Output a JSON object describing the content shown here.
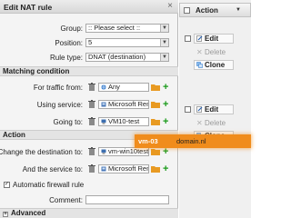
{
  "dialog": {
    "title": "Edit NAT rule",
    "close_glyph": "×",
    "group": {
      "label": "Group:",
      "value": ":: Please select ::"
    },
    "position": {
      "label": "Position:",
      "value": "5"
    },
    "rule_type": {
      "label": "Rule type:",
      "value": "DNAT (destination)"
    },
    "matching_section": "Matching condition",
    "traffic_from": {
      "label": "For traffic from:",
      "value": "Any",
      "icon": "globe-icon"
    },
    "using_service": {
      "label": "Using service:",
      "value": "Microsoft Rem",
      "icon": "service-icon"
    },
    "going_to": {
      "label": "Going to:",
      "value": "VM10-test",
      "icon": "host-icon"
    },
    "action_section": "Action",
    "change_destination": {
      "label": "Change the destination to:",
      "value": "vm-win10test",
      "icon": "host-icon"
    },
    "and_service": {
      "label": "And the service to:",
      "value": "Microsoft Rem",
      "icon": "service-icon"
    },
    "auto_firewall": {
      "label": "Automatic firewall rule",
      "checked": true,
      "check_glyph": "✓"
    },
    "comment": {
      "label": "Comment:",
      "value": ""
    },
    "advanced": {
      "label": "Advanced",
      "expander": "+"
    }
  },
  "panel": {
    "header_label": "Action",
    "header_arrow": "▼",
    "rows": [
      {
        "edit": "Edit",
        "delete": "Delete",
        "clone": "Clone"
      },
      {
        "edit": "Edit",
        "delete": "Delete",
        "clone": "Clone"
      }
    ]
  },
  "tooltip": {
    "left": "vm-03",
    "right": "domain.nl"
  },
  "colors": {
    "accent_orange": "#f08c1c",
    "add_green": "#1a9a1a",
    "folder_orange": "#e89a22"
  }
}
